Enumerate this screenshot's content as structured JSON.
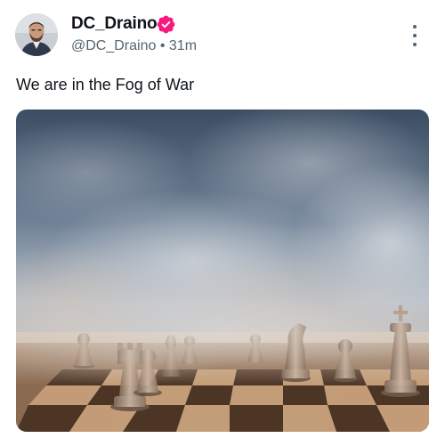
{
  "tweet": {
    "display_name": "DC_Draino",
    "handle": "@DC_Draino",
    "separator": "•",
    "time": "31m",
    "text": "We are in the Fog of War",
    "verified": true,
    "more_icon": "more-vertical-icon"
  },
  "media": {
    "subject": "chess pieces on a chessboard in fog"
  },
  "colors": {
    "verified_badge": "#f91880",
    "handle_text": "#536471",
    "primary_text": "#0f1419"
  }
}
